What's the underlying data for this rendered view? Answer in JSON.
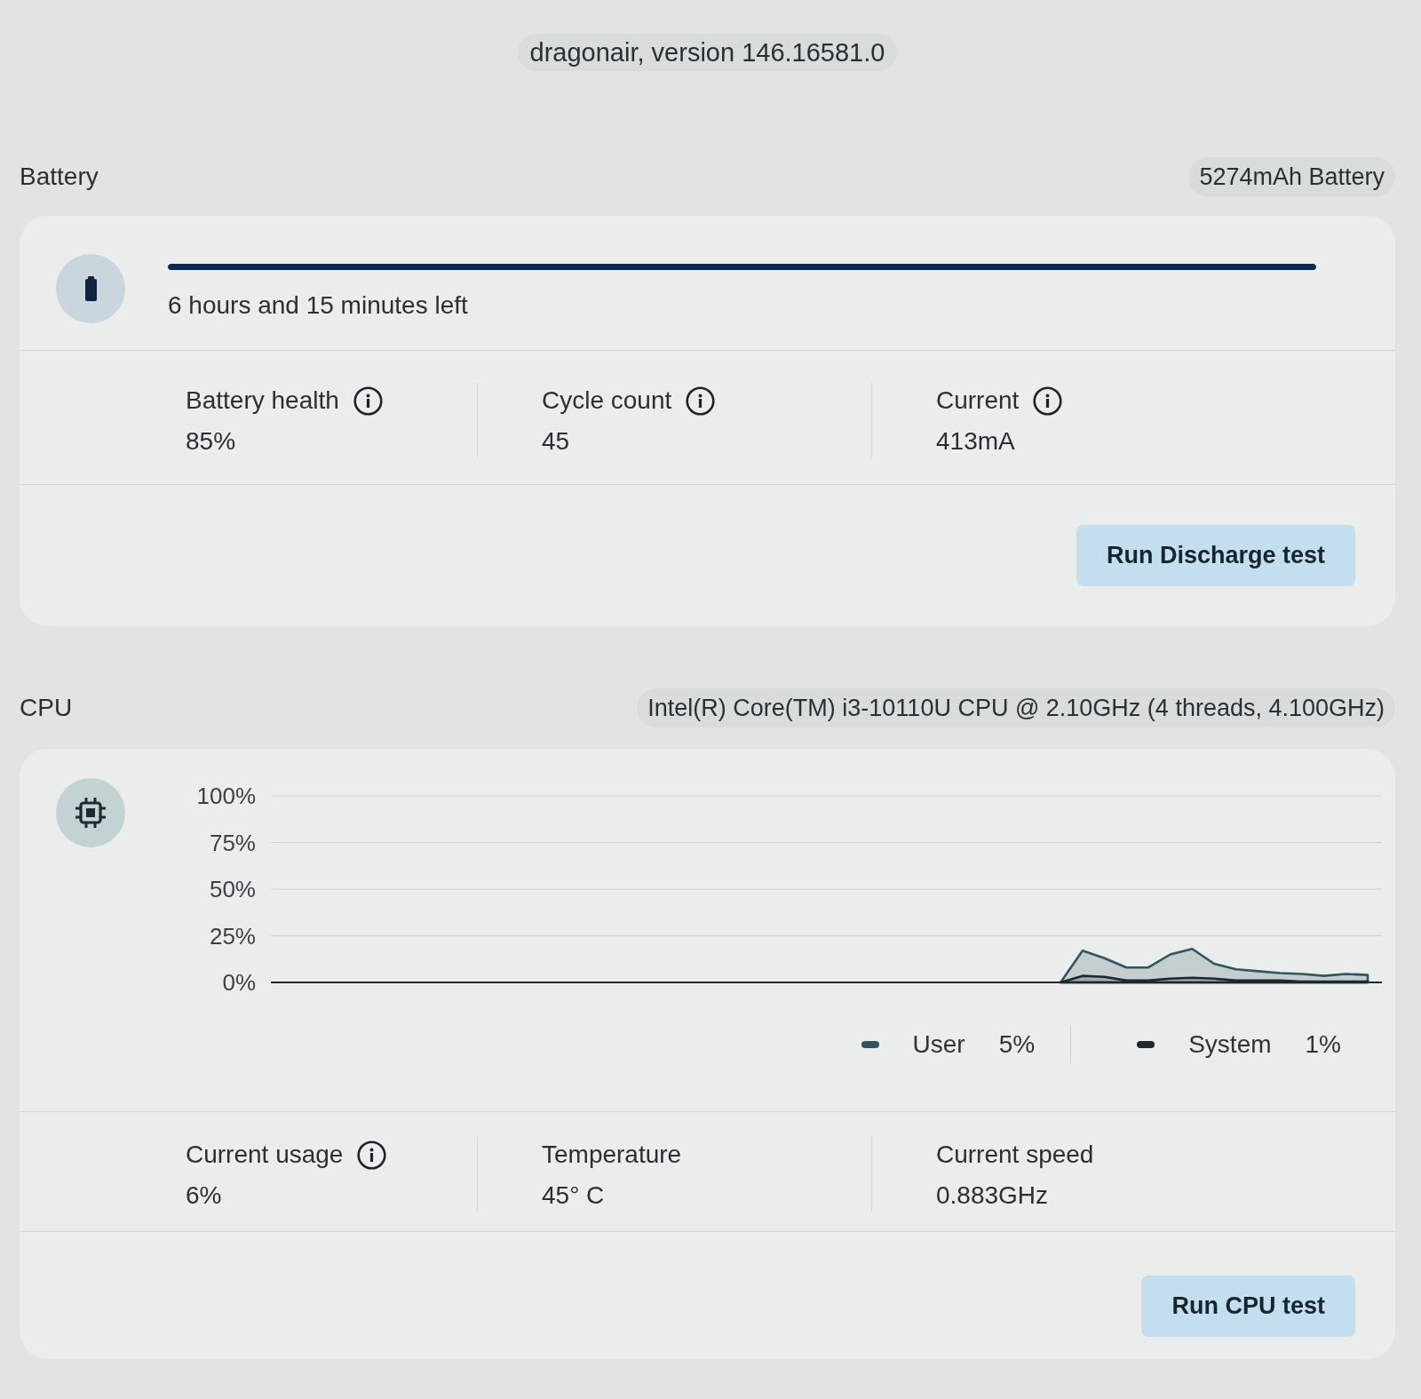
{
  "version": "dragonair, version 146.16581.0",
  "battery": {
    "title": "Battery",
    "model": "5274mAh Battery",
    "charge": {
      "level": 1
    },
    "time_left": "6 hours and 15 minutes left",
    "stats": [
      {
        "label": "Battery health",
        "value": "85%",
        "info": true
      },
      {
        "label": "Cycle count",
        "value": "45",
        "info": true
      },
      {
        "label": "Current",
        "value": "413mA",
        "info": true
      }
    ],
    "button": "Run Discharge test"
  },
  "cpu": {
    "title": "CPU",
    "model": "Intel(R) Core(TM) i3-10110U CPU @ 2.10GHz (4 threads, 4.100GHz)",
    "chart_data": {
      "type": "area",
      "grid": true,
      "ylim": [
        0,
        100
      ],
      "yticks": [
        {
          "value": 100,
          "label": "100%"
        },
        {
          "value": 75,
          "label": "75%"
        },
        {
          "value": 50,
          "label": "50%"
        },
        {
          "value": 25,
          "label": "25%"
        },
        {
          "value": 0,
          "label": "0%"
        }
      ],
      "series": [
        {
          "name": "User",
          "color": "#2e5561",
          "values": [
            null,
            null,
            null,
            null,
            null,
            null,
            null,
            null,
            null,
            null,
            null,
            null,
            null,
            null,
            null,
            null,
            null,
            null,
            null,
            null,
            null,
            null,
            null,
            null,
            null,
            null,
            null,
            null,
            null,
            null,
            null,
            null,
            null,
            null,
            null,
            null,
            0,
            17,
            13,
            8,
            8,
            15,
            18,
            10,
            7,
            6,
            5,
            4.5,
            3.5,
            4.5,
            4
          ]
        },
        {
          "name": "System",
          "color": "#1c282e",
          "values": [
            null,
            null,
            null,
            null,
            null,
            null,
            null,
            null,
            null,
            null,
            null,
            null,
            null,
            null,
            null,
            null,
            null,
            null,
            null,
            null,
            null,
            null,
            null,
            null,
            null,
            null,
            null,
            null,
            null,
            null,
            null,
            null,
            null,
            null,
            null,
            null,
            0,
            3.5,
            3,
            1,
            1,
            2,
            2.5,
            2,
            1,
            1,
            1,
            0.5,
            0.5,
            0.5,
            0.5
          ]
        }
      ]
    },
    "legend": [
      {
        "reading": "5%"
      },
      {
        "reading": "1%"
      }
    ],
    "stats": [
      {
        "label": "Current usage",
        "value": "6%",
        "info": true
      },
      {
        "label": "Temperature",
        "value": "45° C",
        "info": false
      },
      {
        "label": "Current speed",
        "value": "0.883GHz",
        "info": false
      }
    ],
    "button": "Run CPU test"
  }
}
